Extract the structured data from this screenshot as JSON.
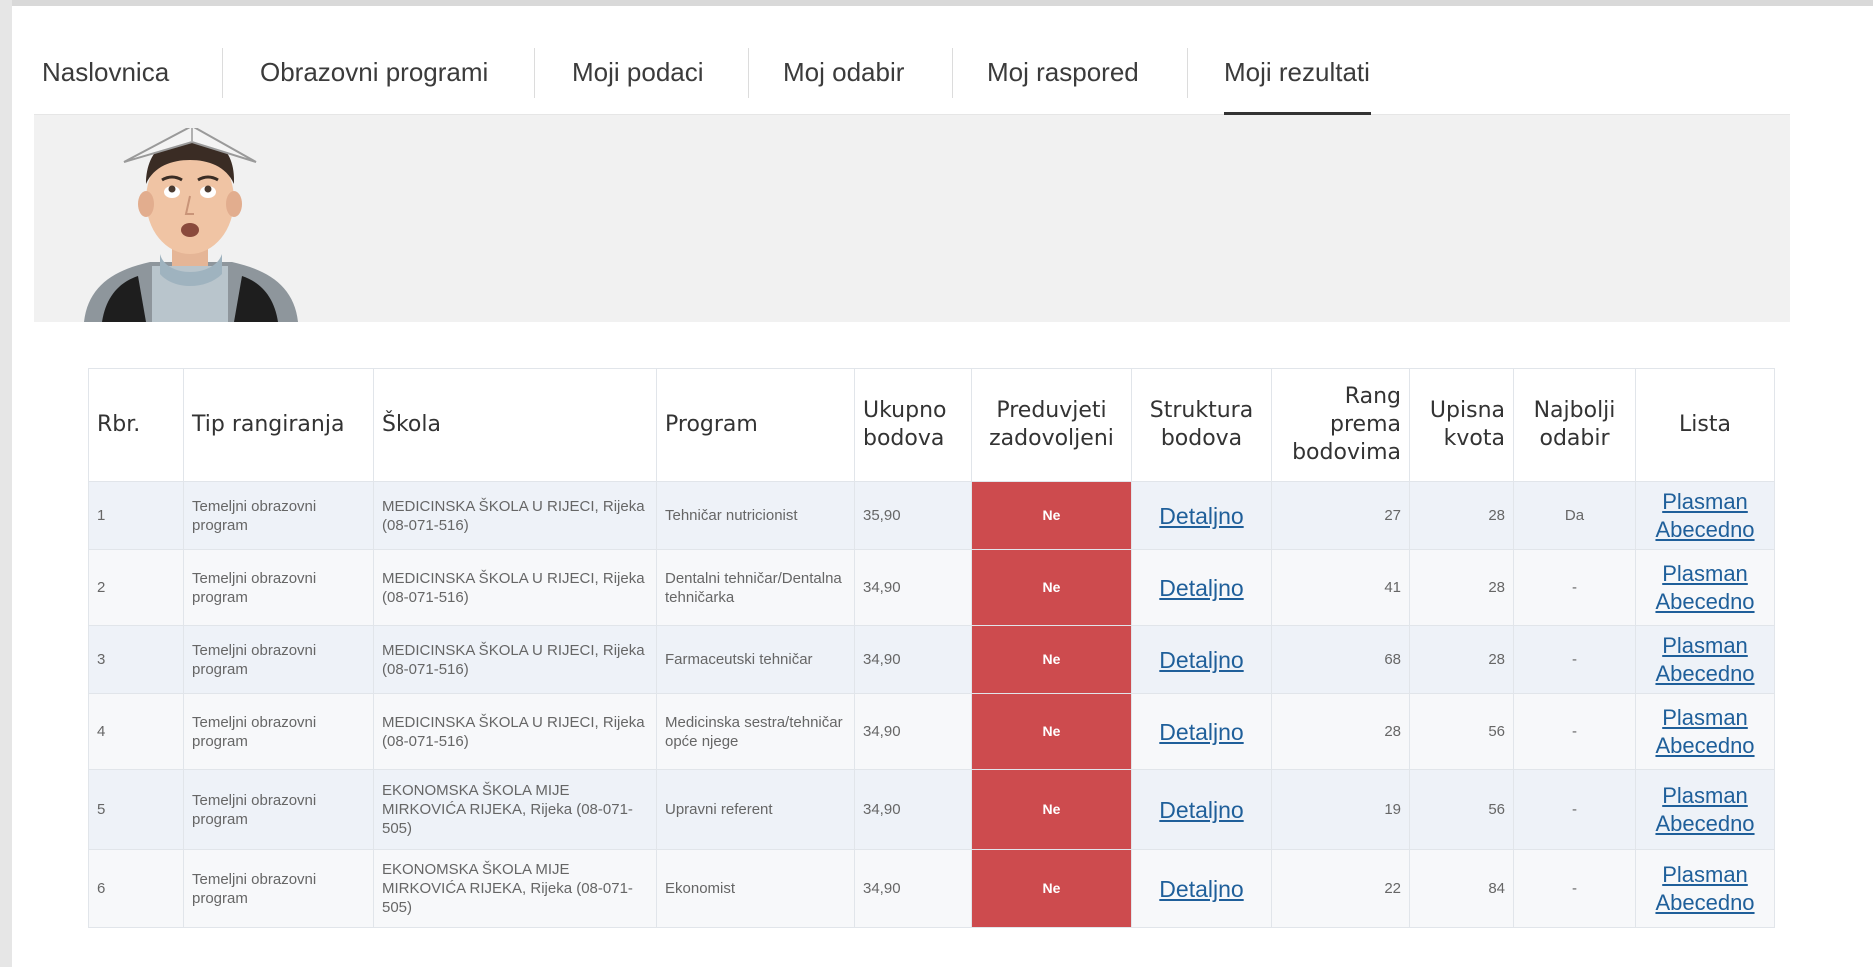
{
  "nav": {
    "items": [
      {
        "label": "Naslovnica",
        "active": false
      },
      {
        "label": "Obrazovni programi",
        "active": false
      },
      {
        "label": "Moji podaci",
        "active": false
      },
      {
        "label": "Moj odabir",
        "active": false
      },
      {
        "label": "Moj raspored",
        "active": false
      },
      {
        "label": "Moji rezultati",
        "active": true
      }
    ]
  },
  "colors": {
    "fail": "#cd4b4e",
    "link": "#1f5f9a",
    "banner": "#f1f1f1"
  },
  "table": {
    "headers": [
      "Rbr.",
      "Tip rangiranja",
      "Škola",
      "Program",
      "Ukupno bodova",
      "Preduvjeti zadovoljeni",
      "Struktura bodova",
      "Rang prema bodovima",
      "Upisna kvota",
      "Najbolji odabir",
      "Lista"
    ],
    "rows": [
      {
        "rbr": "1",
        "tip": "Temeljni obrazovni program",
        "skola": "MEDICINSKA ŠKOLA U RIJECI, Rijeka (08-071-516)",
        "program": "Tehničar nutricionist",
        "bodovi": "35,90",
        "preduvjeti": "Ne",
        "struktura": "Detaljno",
        "rang": "27",
        "kvota": "28",
        "najbolji": "Da",
        "plasman": "Plasman",
        "abecedno": "Abecedno"
      },
      {
        "rbr": "2",
        "tip": "Temeljni obrazovni program",
        "skola": "MEDICINSKA ŠKOLA U RIJECI, Rijeka (08-071-516)",
        "program": "Dentalni tehničar/Dentalna tehničarka",
        "bodovi": "34,90",
        "preduvjeti": "Ne",
        "struktura": "Detaljno",
        "rang": "41",
        "kvota": "28",
        "najbolji": "-",
        "plasman": "Plasman",
        "abecedno": "Abecedno"
      },
      {
        "rbr": "3",
        "tip": "Temeljni obrazovni program",
        "skola": "MEDICINSKA ŠKOLA U RIJECI, Rijeka (08-071-516)",
        "program": "Farmaceutski tehničar",
        "bodovi": "34,90",
        "preduvjeti": "Ne",
        "struktura": "Detaljno",
        "rang": "68",
        "kvota": "28",
        "najbolji": "-",
        "plasman": "Plasman",
        "abecedno": "Abecedno"
      },
      {
        "rbr": "4",
        "tip": "Temeljni obrazovni program",
        "skola": "MEDICINSKA ŠKOLA U RIJECI, Rijeka (08-071-516)",
        "program": "Medicinska sestra/tehničar opće njege",
        "bodovi": "34,90",
        "preduvjeti": "Ne",
        "struktura": "Detaljno",
        "rang": "28",
        "kvota": "56",
        "najbolji": "-",
        "plasman": "Plasman",
        "abecedno": "Abecedno"
      },
      {
        "rbr": "5",
        "tip": "Temeljni obrazovni program",
        "skola": "EKONOMSKA ŠKOLA MIJE MIRKOVIĆA RIJEKA, Rijeka (08-071-505)",
        "program": "Upravni referent",
        "bodovi": "34,90",
        "preduvjeti": "Ne",
        "struktura": "Detaljno",
        "rang": "19",
        "kvota": "56",
        "najbolji": "-",
        "plasman": "Plasman",
        "abecedno": "Abecedno"
      },
      {
        "rbr": "6",
        "tip": "Temeljni obrazovni program",
        "skola": "EKONOMSKA ŠKOLA MIJE MIRKOVIĆA RIJEKA, Rijeka (08-071-505)",
        "program": "Ekonomist",
        "bodovi": "34,90",
        "preduvjeti": "Ne",
        "struktura": "Detaljno",
        "rang": "22",
        "kvota": "84",
        "najbolji": "-",
        "plasman": "Plasman",
        "abecedno": "Abecedno"
      }
    ]
  }
}
